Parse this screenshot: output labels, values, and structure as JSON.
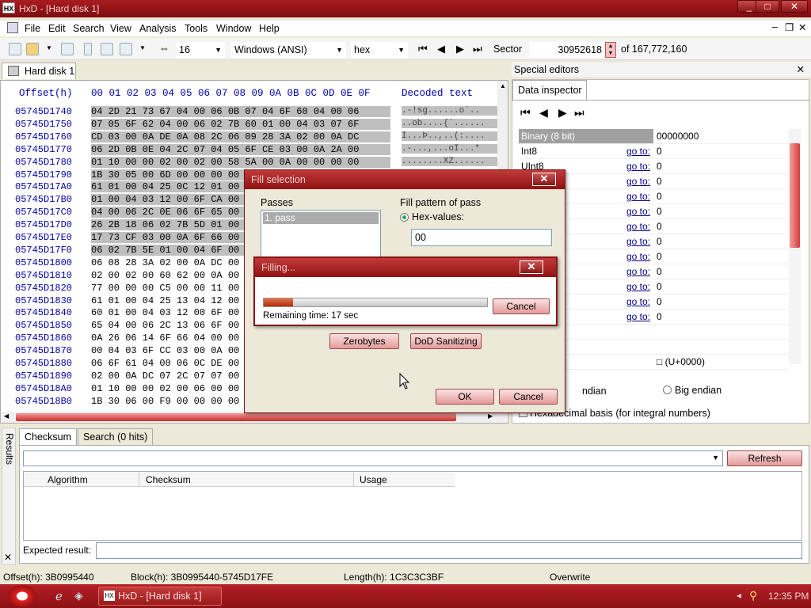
{
  "window": {
    "title": "HxD - [Hard disk 1]",
    "app_icon": "HX"
  },
  "menu": [
    "File",
    "Edit",
    "Search",
    "View",
    "Analysis",
    "Tools",
    "Window",
    "Help"
  ],
  "toolbar": {
    "bytes_per_row": "16",
    "charset": "Windows (ANSI)",
    "base": "hex",
    "sector_label": "Sector",
    "sector_value": "30952618",
    "sector_total": "of 167,772,160"
  },
  "doc_tab": "Hard disk 1",
  "editor": {
    "offset_header": "Offset(h)",
    "column_header": "00 01 02 03 04 05 06 07 08 09 0A 0B 0C 0D 0E 0F",
    "decoded_header": "Decoded text",
    "rows": [
      {
        "offset": "05745D1740",
        "hex": "04 2D 21 73 67 04 00 06 0B 07 04 6F 60 04 00 06",
        "text": ".-!sg......o`.."
      },
      {
        "offset": "05745D1750",
        "hex": "07 05 6F 62 04 00 06 02 7B 60 01 00 04 03 07 6F",
        "text": "..ob....{`......"
      },
      {
        "offset": "05745D1760",
        "hex": "CD 03 00 0A DE 0A 08 2C 06 09 28 3A 02 00 0A DC",
        "text": "Í...Þ..,..(:...."
      },
      {
        "offset": "05745D1770",
        "hex": "06 2D 0B 0E 04 2C 07 04 05 6F CE 03 00 0A 2A 00",
        "text": ".-...,...oÎ...*"
      },
      {
        "offset": "05745D1780",
        "hex": "01 10 00 00 02 00 02 00 58 5A 00 0A 00 00 00 00",
        "text": "........XZ......"
      },
      {
        "offset": "05745D1790",
        "hex": "1B 30 05 00 6D 00 00 00 00 00 00 00 00 00 00 00",
        "text": ""
      },
      {
        "offset": "05745D17A0",
        "hex": "61 01 00 04 25 0C 12 01 00 00 00 00 00 00 00 00",
        "text": ""
      },
      {
        "offset": "05745D17B0",
        "hex": "01 00 04 03 12 00 6F CA 00 00 00 00 00 00 00 00",
        "text": ""
      },
      {
        "offset": "05745D17C0",
        "hex": "04 00 06 2C 0E 06 6F 65 00 00 00 00 00 00 00 00",
        "text": ""
      },
      {
        "offset": "05745D17D0",
        "hex": "26 2B 18 06 02 7B 5D 01 00 00 00 00 00 00 00 00",
        "text": ""
      },
      {
        "offset": "05745D17E0",
        "hex": "17 73 CF 03 00 0A 6F 66 00 00 00 00 00 00 00 00",
        "text": ""
      },
      {
        "offset": "05745D17F0",
        "hex": "06 02 7B 5E 01 00 04 6F 00 00 00 00 00 00 00 00",
        "text": ""
      },
      {
        "offset": "05745D1800",
        "hex": "06 08 28 3A 02 00 0A DC 00 00 00 00 00 00 00 00",
        "text": ""
      },
      {
        "offset": "05745D1810",
        "hex": "02 00 02 00 60 62 00 0A 00 00 00 00 00 00 00 00",
        "text": ""
      },
      {
        "offset": "05745D1820",
        "hex": "77 00 00 00 C5 00 00 11 00 00 00 00 00 00 00 00",
        "text": ""
      },
      {
        "offset": "05745D1830",
        "hex": "61 01 00 04 25 13 04 12 00 00 00 00 00 00 00 00",
        "text": ""
      },
      {
        "offset": "05745D1840",
        "hex": "60 01 00 04 03 12 00 6F 00 00 00 00 00 00 00 00",
        "text": ""
      },
      {
        "offset": "05745D1850",
        "hex": "65 04 00 06 2C 13 06 6F 00 00 00 00 00 00 00 00",
        "text": ""
      },
      {
        "offset": "05745D1860",
        "hex": "0A 26 06 14 6F 66 04 00 00 00 00 00 00 00 00 00",
        "text": ""
      },
      {
        "offset": "05745D1870",
        "hex": "00 04 03 6F CC 03 00 0A 00 00 00 00 00 00 00 00",
        "text": ""
      },
      {
        "offset": "05745D1880",
        "hex": "06 6F 61 04 00 06 0C DE 00 00 00 00 00 00 00 00",
        "text": ""
      },
      {
        "offset": "05745D1890",
        "hex": "02 00 0A DC 07 2C 07 07 00 00 00 00 00 00 00 00",
        "text": ""
      },
      {
        "offset": "05745D18A0",
        "hex": "01 10 00 00 02 00 06 00 00 00 00 00 00 00 00 00",
        "text": ""
      },
      {
        "offset": "05745D18B0",
        "hex": "1B 30 06 00 F9 00 00 00 00 00 00 00 00 00 00 00",
        "text": ""
      }
    ]
  },
  "special_editors": {
    "title": "Special editors",
    "tab": "Data inspector",
    "rows": [
      {
        "label": "Binary (8 bit)",
        "goto": "",
        "value": "00000000"
      },
      {
        "label": "Int8",
        "goto": "go to:",
        "value": "0"
      },
      {
        "label": "UInt8",
        "goto": "go to:",
        "value": "0"
      },
      {
        "label": "",
        "goto": "go to:",
        "value": "0"
      },
      {
        "label": "",
        "goto": "go to:",
        "value": "0"
      },
      {
        "label": "",
        "goto": "go to:",
        "value": "0"
      },
      {
        "label": "",
        "goto": "go to:",
        "value": "0"
      },
      {
        "label": "",
        "goto": "go to:",
        "value": "0"
      },
      {
        "label": "",
        "goto": "go to:",
        "value": "0"
      },
      {
        "label": "",
        "goto": "go to:",
        "value": "0"
      },
      {
        "label": "",
        "goto": "go to:",
        "value": "0"
      },
      {
        "label": "",
        "goto": "go to:",
        "value": "0"
      },
      {
        "label": "",
        "goto": "go to:",
        "value": "0"
      },
      {
        "label": "char8_t",
        "goto": "",
        "value": ""
      },
      {
        "label": "/ char16_t",
        "goto": "",
        "value": ""
      },
      {
        "label": "e point",
        "goto": "",
        "value": "□ (U+0000)"
      }
    ],
    "little_endian_fragment": "ndian",
    "big_endian": "Big endian",
    "hex_basis": "Hexadecimal basis (for integral numbers)"
  },
  "results": {
    "side_label": "Results",
    "tabs": [
      "Checksum",
      "Search (0 hits)"
    ],
    "refresh": "Refresh",
    "columns": [
      "Algorithm",
      "Checksum",
      "Usage"
    ],
    "expected_label": "Expected result:"
  },
  "status": {
    "offset": "Offset(h): 3B0995440",
    "block": "Block(h): 3B0995440-5745D17FE",
    "length": "Length(h): 1C3C3C3BF",
    "mode": "Overwrite"
  },
  "taskbar": {
    "task": "HxD - [Hard disk 1]",
    "clock": "12:35 PM"
  },
  "fill_dialog": {
    "title": "Fill selection",
    "passes_label": "Passes",
    "pass_item": "1. pass",
    "pattern_label": "Fill pattern of pass",
    "hex_values_label": "Hex-values:",
    "hex_value": "00",
    "zerobytes": "Zerobytes",
    "dod": "DoD Sanitizing",
    "ok": "OK",
    "cancel": "Cancel"
  },
  "progress_dialog": {
    "title": "Filling...",
    "remaining": "Remaining time: 17 sec",
    "cancel": "Cancel",
    "progress": 0.13
  }
}
